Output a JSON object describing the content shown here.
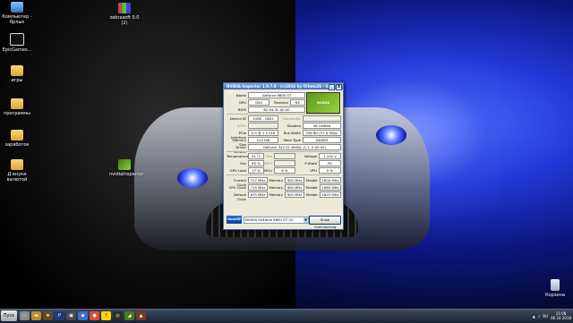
{
  "desktop": {
    "icons": [
      {
        "label": "Компьютер - Ярлык",
        "kind": "computer"
      },
      {
        "label": "EpicGames...",
        "kind": "epic"
      },
      {
        "label": "игры",
        "kind": "folder"
      },
      {
        "label": "программы",
        "kind": "folder"
      },
      {
        "label": "заработок",
        "kind": "folder"
      },
      {
        "label": "Д внуки валютой",
        "kind": "folder"
      },
      {
        "label": "zebrasoft 0.0 (2)",
        "kind": "archive"
      },
      {
        "label": "nvidiaInspector",
        "kind": "nvidia"
      },
      {
        "label": "Корзина",
        "kind": "trash"
      }
    ]
  },
  "window": {
    "title": "NVIDIA Inspector 1.9.7.8 - (c)2016 by Orbmu2k - GPU 1/1 (1)",
    "controls": {
      "minimize": "_",
      "close": "X"
    },
    "logo_text": "NVIDIA",
    "fields": {
      "name_label": "Name",
      "name": "GeForce 9600 GT",
      "gpu_label": "GPU",
      "gpu": "G94",
      "revision_label": "Revision",
      "revision": "B1",
      "bios_label": "BIOS",
      "bios": "62.94.3C.00.00",
      "device_id_label": "Device ID",
      "device_id": "10DE - 0622",
      "subvendor_label": "Subvendor",
      "subvendor": "",
      "rops_label": "ROPs",
      "rops": "",
      "shaders_label": "Shaders",
      "shaders": "48 Unified",
      "pcie_label": "PCIe Interface",
      "pcie": "2.0 @ 2.0 x16",
      "bus_width_label": "Bus Width",
      "bus_width": "256 Bit (57.6 GB/s)",
      "memory_size_label": "Memory Size",
      "memory_size": "512 MB",
      "mem_type_label": "Mem Type",
      "mem_type": "GDDR3",
      "driver_label": "Driver Version",
      "driver": "GeForce 342.01 WHQL (1.1. 0.00.00)",
      "temperature_label": "Temperature",
      "temperature": "53 °C",
      "fan_label": "Fan",
      "fan": "",
      "voltage_label": "Voltage",
      "voltage": "1.100 V",
      "fan_pct_label": "Fan",
      "fan_pct": "65 %",
      "mcu_label": "MCU",
      "mcu": "",
      "pstate_label": "P-State",
      "pstate": "P0",
      "gpu_load_label": "GPU Load",
      "gpu_load": "17 %",
      "mcu_load_label": "MCU",
      "mcu_load": "6 %",
      "vpu_label": "VPU",
      "vpu": "0 %",
      "current_clock_label": "Current Clock",
      "current_clock": "717 MHz",
      "current_mem_label": "Memory",
      "current_mem": "900 MHz",
      "current_shader_label": "Shader",
      "current_shader": "1800 MHz",
      "gpu_clock_label": "GPU Clock",
      "gpu_clock": "715 MHz",
      "gpu_mem_label": "Memory",
      "gpu_mem": "900 MHz",
      "gpu_shader_label": "Shader",
      "gpu_shader": "1665 MHz",
      "default_clock_label": "Default Clock",
      "default_clock": "675 MHz",
      "default_mem_label": "Memory",
      "default_mem": "900 MHz",
      "default_shader_label": "Shader",
      "default_shader": "1625 MHz"
    },
    "vendor_logo": "Inno3D",
    "gpu_select": "NVIDIA GeForce 9600 GT (0)",
    "overclocking_button": "Show Overclocking"
  },
  "taskbar": {
    "start_label": "Пуск",
    "clock_time": "11:08",
    "clock_date": "06.10.2018",
    "lang": "RU"
  }
}
